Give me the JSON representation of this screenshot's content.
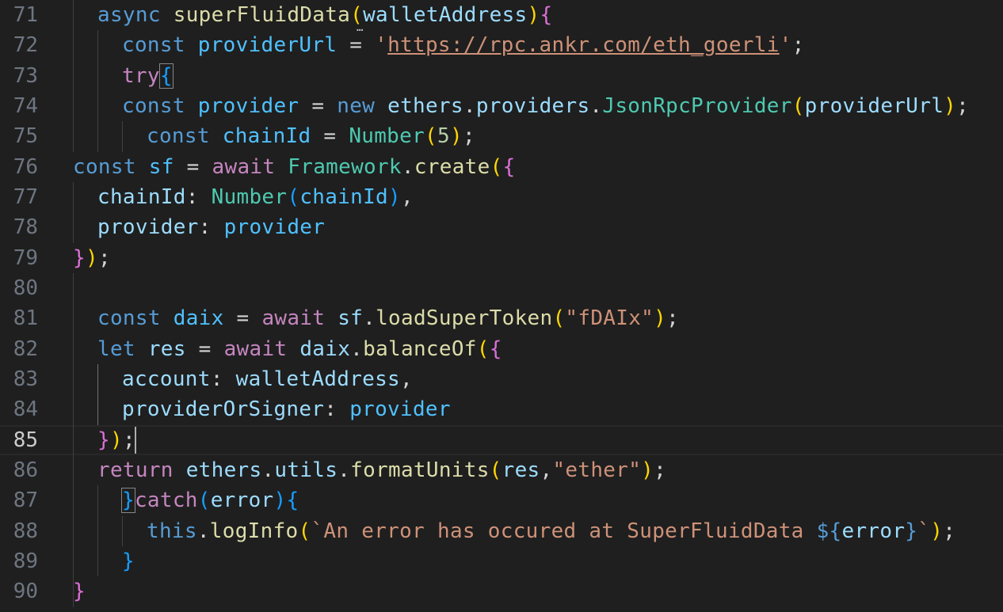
{
  "editor": {
    "lines": [
      {
        "num": "71",
        "tokens": [
          [
            "kw",
            "async"
          ],
          [
            "p",
            " "
          ],
          [
            "fn",
            "superFluidData"
          ],
          [
            "b1",
            "("
          ],
          [
            "var",
            "walletAddress"
          ],
          [
            "b1",
            ")"
          ],
          [
            "b2",
            "{"
          ]
        ]
      },
      {
        "num": "72",
        "tokens": [
          [
            "kw",
            "const"
          ],
          [
            "p",
            " "
          ],
          [
            "const",
            "providerUrl"
          ],
          [
            "p",
            " = "
          ],
          [
            "str",
            "'"
          ],
          [
            "str url",
            "https://rpc.ankr.com/eth_goerli"
          ],
          [
            "str",
            "'"
          ],
          [
            "p",
            ";"
          ]
        ]
      },
      {
        "num": "73",
        "tokens": [
          [
            "kw2",
            "try"
          ],
          [
            "b3 bracket-box",
            "{"
          ]
        ]
      },
      {
        "num": "74",
        "tokens": [
          [
            "kw",
            "const"
          ],
          [
            "p",
            " "
          ],
          [
            "const",
            "provider"
          ],
          [
            "p",
            " = "
          ],
          [
            "kw",
            "new"
          ],
          [
            "p",
            " "
          ],
          [
            "var",
            "ethers"
          ],
          [
            "p",
            "."
          ],
          [
            "var",
            "providers"
          ],
          [
            "p",
            "."
          ],
          [
            "cls",
            "JsonRpcProvider"
          ],
          [
            "b1",
            "("
          ],
          [
            "var",
            "providerUrl"
          ],
          [
            "b1",
            ")"
          ],
          [
            "p",
            ";"
          ]
        ]
      },
      {
        "num": "75",
        "tokens": [
          [
            "kw",
            "const"
          ],
          [
            "p",
            " "
          ],
          [
            "const",
            "chainId"
          ],
          [
            "p",
            " = "
          ],
          [
            "cls",
            "Number"
          ],
          [
            "b1",
            "("
          ],
          [
            "num",
            "5"
          ],
          [
            "b1",
            ")"
          ],
          [
            "p",
            ";"
          ]
        ]
      },
      {
        "num": "76",
        "tokens": [
          [
            "kw",
            "const"
          ],
          [
            "p",
            " "
          ],
          [
            "const",
            "sf"
          ],
          [
            "p",
            " = "
          ],
          [
            "kw2",
            "await"
          ],
          [
            "p",
            " "
          ],
          [
            "cls",
            "Framework"
          ],
          [
            "p",
            "."
          ],
          [
            "fn",
            "create"
          ],
          [
            "b1",
            "("
          ],
          [
            "b2",
            "{"
          ]
        ]
      },
      {
        "num": "77",
        "tokens": [
          [
            "var",
            "chainId"
          ],
          [
            "p",
            ": "
          ],
          [
            "cls",
            "Number"
          ],
          [
            "b3",
            "("
          ],
          [
            "const",
            "chainId"
          ],
          [
            "b3",
            ")"
          ],
          [
            "p",
            ","
          ]
        ]
      },
      {
        "num": "78",
        "tokens": [
          [
            "var",
            "provider"
          ],
          [
            "p",
            ": "
          ],
          [
            "const",
            "provider"
          ]
        ]
      },
      {
        "num": "79",
        "tokens": [
          [
            "b2",
            "}"
          ],
          [
            "b1",
            ")"
          ],
          [
            "p",
            ";"
          ]
        ]
      },
      {
        "num": "80",
        "tokens": []
      },
      {
        "num": "81",
        "tokens": [
          [
            "kw",
            "const"
          ],
          [
            "p",
            " "
          ],
          [
            "const",
            "daix"
          ],
          [
            "p",
            " = "
          ],
          [
            "kw2",
            "await"
          ],
          [
            "p",
            " "
          ],
          [
            "var",
            "sf"
          ],
          [
            "p",
            "."
          ],
          [
            "fn",
            "loadSuperToken"
          ],
          [
            "b1",
            "("
          ],
          [
            "str",
            "\"fDAIx\""
          ],
          [
            "b1",
            ")"
          ],
          [
            "p",
            ";"
          ]
        ]
      },
      {
        "num": "82",
        "tokens": [
          [
            "kw",
            "let"
          ],
          [
            "p",
            " "
          ],
          [
            "var",
            "res"
          ],
          [
            "p",
            " = "
          ],
          [
            "kw2",
            "await"
          ],
          [
            "p",
            " "
          ],
          [
            "var",
            "daix"
          ],
          [
            "p",
            "."
          ],
          [
            "fn",
            "balanceOf"
          ],
          [
            "b1",
            "("
          ],
          [
            "b2",
            "{"
          ]
        ]
      },
      {
        "num": "83",
        "tokens": [
          [
            "var",
            "account"
          ],
          [
            "p",
            ": "
          ],
          [
            "var",
            "walletAddress"
          ],
          [
            "p",
            ","
          ]
        ]
      },
      {
        "num": "84",
        "tokens": [
          [
            "var",
            "providerOrSigner"
          ],
          [
            "p",
            ": "
          ],
          [
            "const",
            "provider"
          ]
        ]
      },
      {
        "num": "85",
        "tokens": [
          [
            "b2",
            "}"
          ],
          [
            "b1",
            ")"
          ],
          [
            "p",
            ";"
          ]
        ]
      },
      {
        "num": "86",
        "tokens": [
          [
            "kw2",
            "return"
          ],
          [
            "p",
            " "
          ],
          [
            "var",
            "ethers"
          ],
          [
            "p",
            "."
          ],
          [
            "var",
            "utils"
          ],
          [
            "p",
            "."
          ],
          [
            "fn",
            "formatUnits"
          ],
          [
            "b1",
            "("
          ],
          [
            "var",
            "res"
          ],
          [
            "p",
            ","
          ],
          [
            "str",
            "\"ether\""
          ],
          [
            "b1",
            ")"
          ],
          [
            "p",
            ";"
          ]
        ]
      },
      {
        "num": "87",
        "tokens": [
          [
            "b3 bracket-box",
            "}"
          ],
          [
            "kw2",
            "catch"
          ],
          [
            "b3",
            "("
          ],
          [
            "var",
            "error"
          ],
          [
            "b3",
            ")"
          ],
          [
            "b3",
            "{"
          ]
        ]
      },
      {
        "num": "88",
        "tokens": [
          [
            "kw",
            "this"
          ],
          [
            "p",
            "."
          ],
          [
            "fn",
            "logInfo"
          ],
          [
            "b1",
            "("
          ],
          [
            "str",
            "`An error has occured at SuperFluidData "
          ],
          [
            "kw",
            "${"
          ],
          [
            "var",
            "error"
          ],
          [
            "kw",
            "}"
          ],
          [
            "str",
            "`"
          ],
          [
            "b1",
            ")"
          ],
          [
            "p",
            ";"
          ]
        ]
      },
      {
        "num": "89",
        "tokens": [
          [
            "b3",
            "}"
          ]
        ]
      },
      {
        "num": "90",
        "tokens": [
          [
            "b2",
            "}"
          ]
        ]
      }
    ],
    "current_line": "85"
  }
}
